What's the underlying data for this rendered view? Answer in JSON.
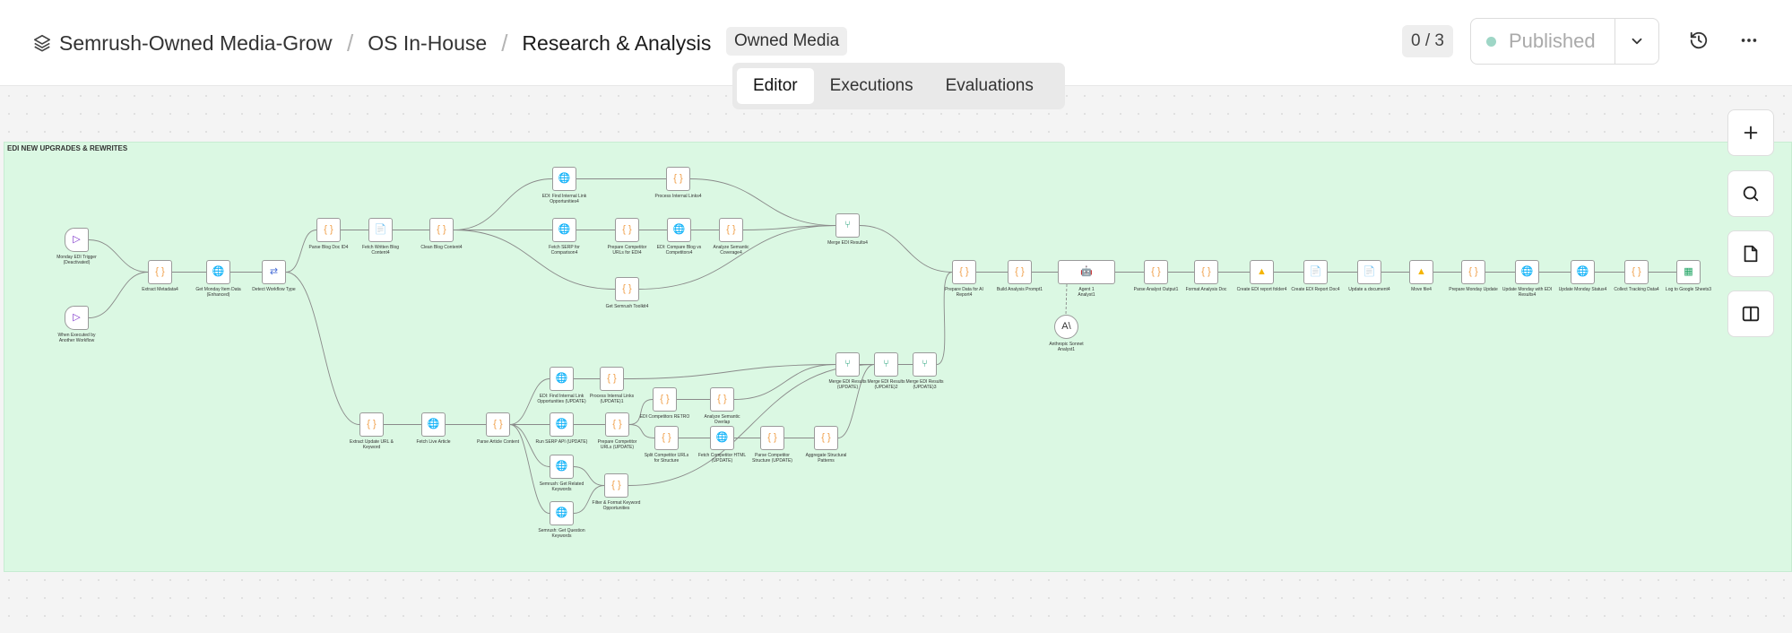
{
  "breadcrumb": {
    "project": "Semrush-Owned Media-Growth",
    "folder": "OS In-House",
    "title": "Research & Analysis"
  },
  "tag": "Owned Media",
  "version_counter": "0 / 3",
  "publish": {
    "label": "Published",
    "status_color": "#9ed6c6"
  },
  "tabs": [
    {
      "label": "Editor",
      "active": true
    },
    {
      "label": "Executions",
      "active": false
    },
    {
      "label": "Evaluations",
      "active": false
    }
  ],
  "canvas": {
    "sticky_title": "EDI NEW UPGRADES & REWRITES",
    "nodes": [
      {
        "id": "n1",
        "label": "Monday EDI Trigger\n(Deactivated)",
        "icon": "monday-icon",
        "kind": "trigger"
      },
      {
        "id": "n2",
        "label": "When Executed by\nAnother Workflow",
        "icon": "execute-workflow-icon",
        "kind": "trigger"
      },
      {
        "id": "n3",
        "label": "Extract Metadata4",
        "icon": "code-icon",
        "kind": "code"
      },
      {
        "id": "n4",
        "label": "Get Monday Item Data\n(Enhanced)",
        "icon": "http-icon",
        "kind": "http"
      },
      {
        "id": "n5",
        "label": "Detect Workflow Type",
        "icon": "switch-icon",
        "kind": "switch"
      },
      {
        "id": "n6",
        "label": "Parse Blog Doc ID4",
        "icon": "code-icon",
        "kind": "code"
      },
      {
        "id": "n7",
        "label": "Fetch Written Blog\nContent4",
        "icon": "google-docs-icon",
        "kind": "docs"
      },
      {
        "id": "n8",
        "label": "Clean Blog Content4",
        "icon": "code-icon",
        "kind": "code"
      },
      {
        "id": "n9",
        "label": "EDI: Find Internal Link\nOpportunities4",
        "icon": "http-icon",
        "kind": "http"
      },
      {
        "id": "n10",
        "label": "Process Internal Links4",
        "icon": "code-icon",
        "kind": "code"
      },
      {
        "id": "n11",
        "label": "Fetch SERP for\nComparison4",
        "icon": "http-icon",
        "kind": "http"
      },
      {
        "id": "n12",
        "label": "Prepare Competitor\nURLs for EDI4",
        "icon": "code-icon",
        "kind": "code"
      },
      {
        "id": "n13",
        "label": "EDI: Compare Blog vs\nCompetitors4",
        "icon": "http-icon",
        "kind": "http"
      },
      {
        "id": "n14",
        "label": "Analyze Semantic\nCoverage4",
        "icon": "code-icon",
        "kind": "code"
      },
      {
        "id": "n15",
        "label": "Merge EDI Results4",
        "icon": "merge-icon",
        "kind": "merge"
      },
      {
        "id": "n16",
        "label": "Get Semrush Toolkit4",
        "icon": "code-icon",
        "kind": "code"
      },
      {
        "id": "n17",
        "label": "Prepare Data for AI\nReport4",
        "icon": "code-icon",
        "kind": "code"
      },
      {
        "id": "n18",
        "label": "Build Analysis Prompt1",
        "icon": "code-icon",
        "kind": "code"
      },
      {
        "id": "n19",
        "label": "Agent 1\nAnalyst1",
        "icon": "robot-icon",
        "kind": "ai"
      },
      {
        "id": "n20",
        "label": "Anthropic Sonnet\nAnalyst1",
        "icon": "anthropic-icon",
        "kind": "model"
      },
      {
        "id": "n21",
        "label": "Parse Analyst Output1",
        "icon": "code-icon",
        "kind": "code"
      },
      {
        "id": "n22",
        "label": "Format Analysis Doc",
        "icon": "code-icon",
        "kind": "code"
      },
      {
        "id": "n23",
        "label": "Create EDI report folder4",
        "icon": "google-drive-icon",
        "kind": "drive"
      },
      {
        "id": "n24",
        "label": "Create EDI Report Doc4",
        "icon": "google-docs-icon",
        "kind": "docs"
      },
      {
        "id": "n25",
        "label": "Update a document4",
        "icon": "google-docs-icon",
        "kind": "docs"
      },
      {
        "id": "n26",
        "label": "Move file4",
        "icon": "google-drive-icon",
        "kind": "drive"
      },
      {
        "id": "n27",
        "label": "Prepare Monday Update",
        "icon": "code-icon",
        "kind": "code"
      },
      {
        "id": "n28",
        "label": "Update Monday with EDI\nResults4",
        "icon": "http-icon",
        "kind": "http"
      },
      {
        "id": "n29",
        "label": "Update Monday Status4",
        "icon": "http-icon",
        "kind": "http"
      },
      {
        "id": "n30",
        "label": "Collect Tracking Data4",
        "icon": "code-icon",
        "kind": "code"
      },
      {
        "id": "n31",
        "label": "Log to Google Sheets3",
        "icon": "google-sheets-icon",
        "kind": "sheets"
      },
      {
        "id": "n32",
        "label": "Extract Update URL &\nKeyword",
        "icon": "code-icon",
        "kind": "code"
      },
      {
        "id": "n33",
        "label": "Fetch Live Article",
        "icon": "http-icon",
        "kind": "http"
      },
      {
        "id": "n34",
        "label": "Parse Article Content",
        "icon": "code-icon",
        "kind": "code"
      },
      {
        "id": "n35",
        "label": "EDI: Find Internal Link\nOpportunities (UPDATE)",
        "icon": "http-icon",
        "kind": "http"
      },
      {
        "id": "n36",
        "label": "Process Internal Links\n(UPDATE)1",
        "icon": "code-icon",
        "kind": "code"
      },
      {
        "id": "n37",
        "label": "EDI Competitors RETRO",
        "icon": "code-icon",
        "kind": "code"
      },
      {
        "id": "n38",
        "label": "Analyze Semantic\nOverlap",
        "icon": "code-icon",
        "kind": "code"
      },
      {
        "id": "n39",
        "label": "Run SERP API (UPDATE)",
        "icon": "http-icon",
        "kind": "http"
      },
      {
        "id": "n40",
        "label": "Prepare Competitor\nURLs (UPDATE)",
        "icon": "code-icon",
        "kind": "code"
      },
      {
        "id": "n41",
        "label": "Split Competitor URLs\nfor Structure",
        "icon": "code-icon",
        "kind": "code"
      },
      {
        "id": "n42",
        "label": "Fetch Competitor HTML\n(UPDATE)",
        "icon": "http-icon",
        "kind": "http"
      },
      {
        "id": "n43",
        "label": "Parse Competitor\nStructure (UPDATE)",
        "icon": "code-icon",
        "kind": "code"
      },
      {
        "id": "n44",
        "label": "Aggregate Structural\nPatterns",
        "icon": "code-icon",
        "kind": "code"
      },
      {
        "id": "n45",
        "label": "Semrush: Get Related\nKeywords",
        "icon": "http-icon",
        "kind": "http"
      },
      {
        "id": "n46",
        "label": "Filter & Format Keyword\nOpportunities",
        "icon": "code-icon",
        "kind": "code"
      },
      {
        "id": "n47",
        "label": "Semrush: Get Question\nKeywords",
        "icon": "http-icon",
        "kind": "http"
      },
      {
        "id": "n48",
        "label": "Merge EDI Results\n(UPDATE)",
        "icon": "merge-icon",
        "kind": "merge"
      },
      {
        "id": "n49",
        "label": "Merge EDI Results\n(UPDATE)2",
        "icon": "merge-icon",
        "kind": "merge"
      },
      {
        "id": "n50",
        "label": "Merge EDI Results\n(UPDATE)3",
        "icon": "merge-icon",
        "kind": "merge"
      }
    ],
    "edges": [
      [
        "n1",
        "n3"
      ],
      [
        "n2",
        "n3"
      ],
      [
        "n3",
        "n4"
      ],
      [
        "n4",
        "n5"
      ],
      [
        "n5",
        "n6"
      ],
      [
        "n5",
        "n32"
      ],
      [
        "n6",
        "n7"
      ],
      [
        "n7",
        "n8"
      ],
      [
        "n8",
        "n9"
      ],
      [
        "n8",
        "n11"
      ],
      [
        "n8",
        "n16"
      ],
      [
        "n9",
        "n10"
      ],
      [
        "n10",
        "n15"
      ],
      [
        "n11",
        "n12"
      ],
      [
        "n12",
        "n13"
      ],
      [
        "n13",
        "n14"
      ],
      [
        "n14",
        "n15"
      ],
      [
        "n16",
        "n15"
      ],
      [
        "n15",
        "n17"
      ],
      [
        "n17",
        "n18"
      ],
      [
        "n18",
        "n19"
      ],
      [
        "n19",
        "n21"
      ],
      [
        "n21",
        "n22"
      ],
      [
        "n22",
        "n23"
      ],
      [
        "n23",
        "n24"
      ],
      [
        "n24",
        "n25"
      ],
      [
        "n25",
        "n26"
      ],
      [
        "n26",
        "n27"
      ],
      [
        "n27",
        "n28"
      ],
      [
        "n28",
        "n29"
      ],
      [
        "n29",
        "n30"
      ],
      [
        "n30",
        "n31"
      ],
      [
        "n32",
        "n33"
      ],
      [
        "n33",
        "n34"
      ],
      [
        "n34",
        "n35"
      ],
      [
        "n34",
        "n39"
      ],
      [
        "n34",
        "n45"
      ],
      [
        "n34",
        "n47"
      ],
      [
        "n35",
        "n36"
      ],
      [
        "n36",
        "n48"
      ],
      [
        "n39",
        "n40"
      ],
      [
        "n40",
        "n37"
      ],
      [
        "n40",
        "n41"
      ],
      [
        "n37",
        "n38"
      ],
      [
        "n38",
        "n48"
      ],
      [
        "n41",
        "n42"
      ],
      [
        "n42",
        "n43"
      ],
      [
        "n43",
        "n44"
      ],
      [
        "n44",
        "n49"
      ],
      [
        "n45",
        "n46"
      ],
      [
        "n47",
        "n46"
      ],
      [
        "n46",
        "n49"
      ],
      [
        "n48",
        "n49"
      ],
      [
        "n49",
        "n50"
      ],
      [
        "n50",
        "n17"
      ]
    ]
  },
  "colors": {
    "sticky_bg": "#dbf8e3",
    "code_icon": "#f0a04b",
    "http_icon": "#4a6fd8",
    "docs_icon": "#4285f4",
    "sheets_icon": "#1ea362",
    "merge_icon": "#2aa37c"
  },
  "icons": {
    "project": "layers-icon",
    "history": "history-icon",
    "more": "more-horizontal-icon",
    "caret": "chevron-down-icon",
    "zoom_in": "plus-icon",
    "search": "search-icon",
    "sticky": "sticky-note-icon",
    "panel": "side-panel-icon"
  }
}
